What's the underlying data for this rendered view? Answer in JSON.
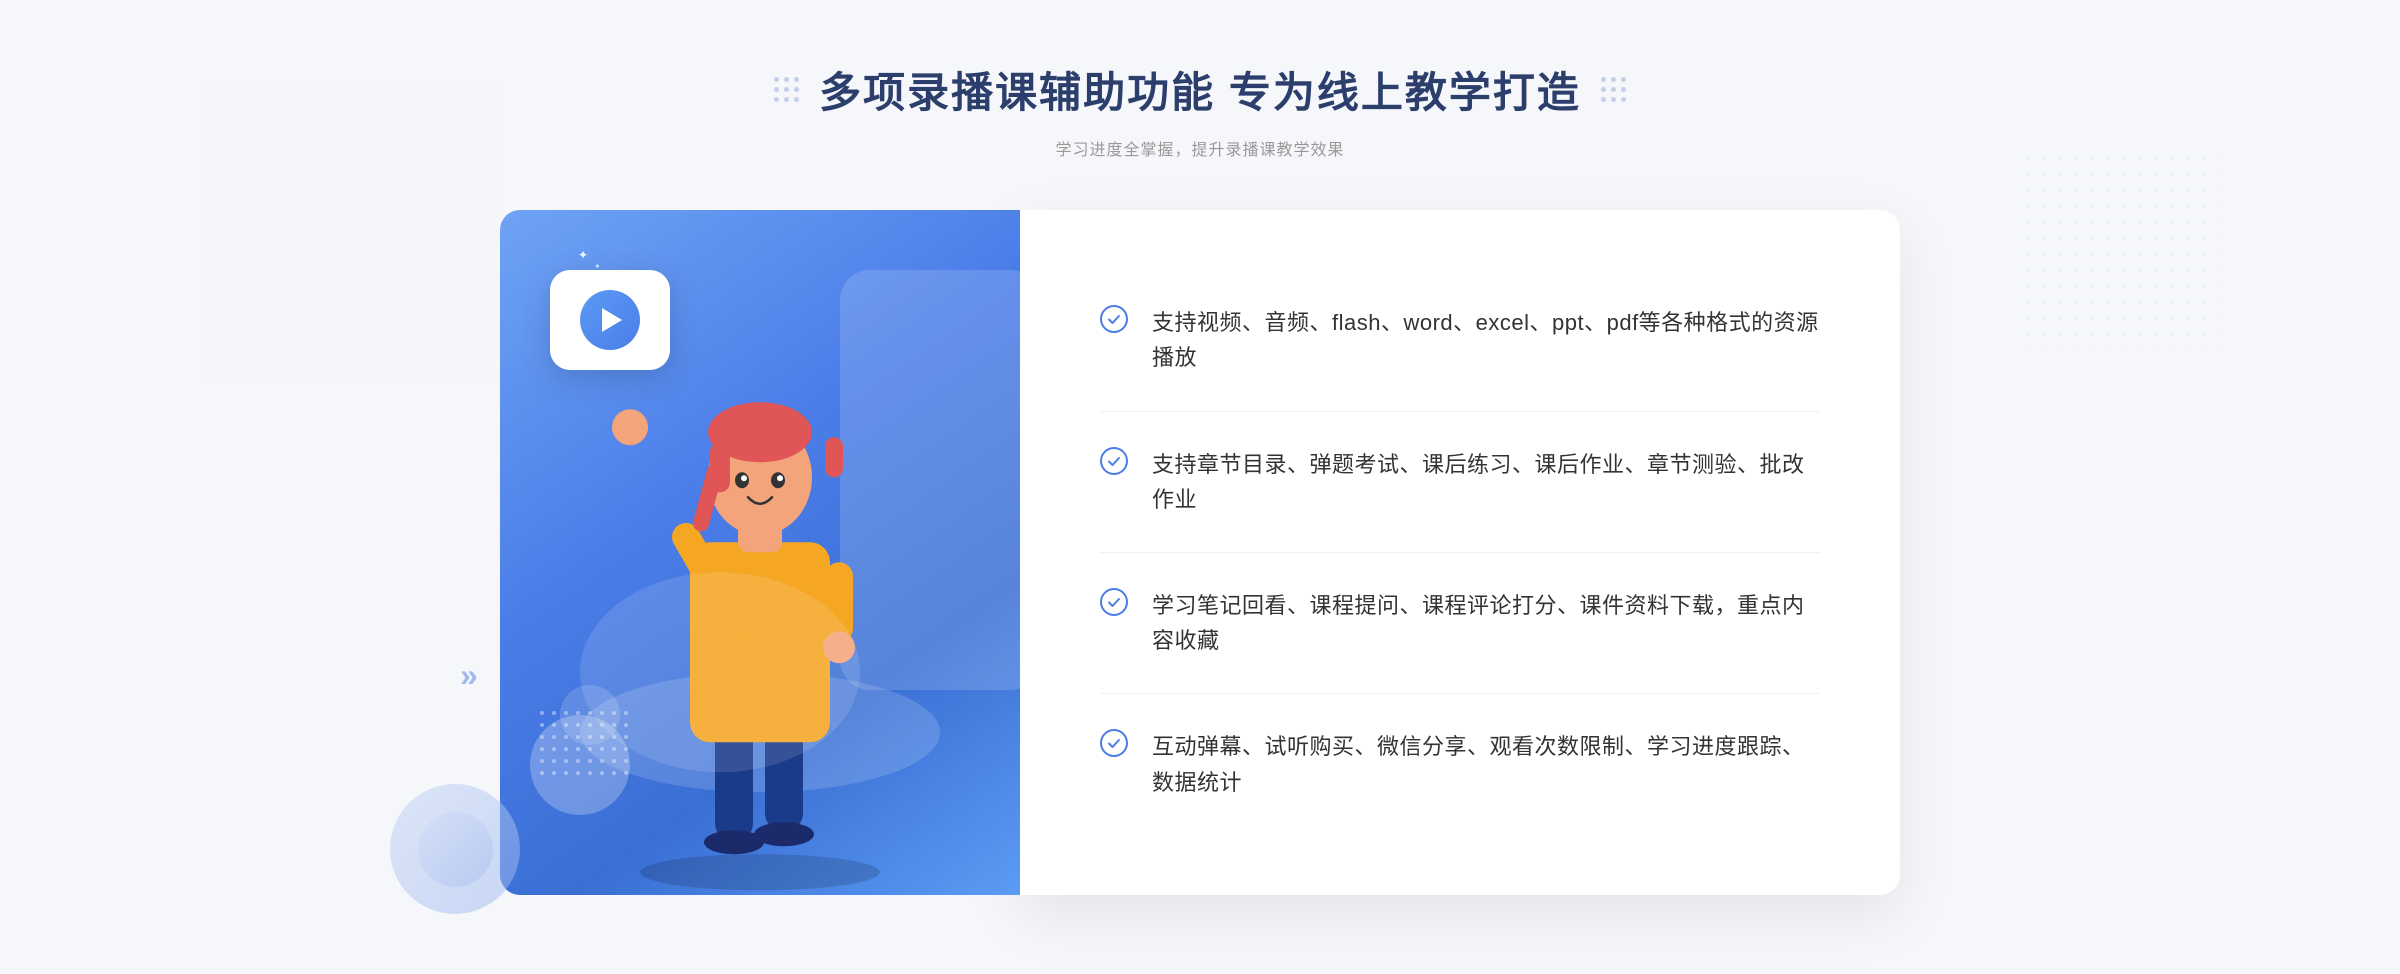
{
  "header": {
    "title": "多项录播课辅助功能 专为线上教学打造",
    "subtitle": "学习进度全掌握，提升录播课教学效果"
  },
  "features": [
    {
      "id": 1,
      "text": "支持视频、音频、flash、word、excel、ppt、pdf等各种格式的资源播放"
    },
    {
      "id": 2,
      "text": "支持章节目录、弹题考试、课后练习、课后作业、章节测验、批改作业"
    },
    {
      "id": 3,
      "text": "学习笔记回看、课程提问、课程评论打分、课件资料下载，重点内容收藏"
    },
    {
      "id": 4,
      "text": "互动弹幕、试听购买、微信分享、观看次数限制、学习进度跟踪、数据统计"
    }
  ],
  "colors": {
    "primary": "#4b7de8",
    "title": "#2c3e6b",
    "text": "#333333",
    "subtitle": "#999999",
    "border": "#f0f0f0"
  },
  "icons": {
    "check": "✓",
    "play": "▶",
    "chevron_right": "»",
    "sparkle": "✦"
  }
}
